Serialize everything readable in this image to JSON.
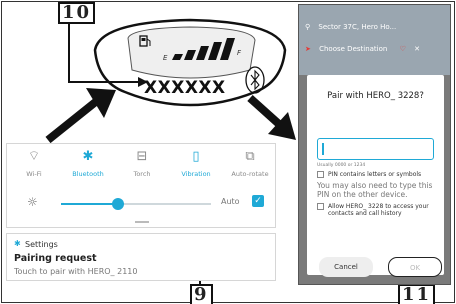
{
  "dashboard": {
    "code": "XXXXXX",
    "fuel_gauge": "E ▰▰▰▰▰ F"
  },
  "steps": {
    "step10": "10",
    "step9": "9",
    "step11": "11"
  },
  "quick_settings": {
    "tiles": [
      {
        "label": "Wi-Fi",
        "icon": "wifi-icon",
        "glyph": "⌔"
      },
      {
        "label": "Bluetooth",
        "icon": "bluetooth-icon",
        "glyph": "✱"
      },
      {
        "label": "Torch",
        "icon": "torch-icon",
        "glyph": "⊟"
      },
      {
        "label": "Vibration",
        "icon": "vibration-icon",
        "glyph": "▯"
      },
      {
        "label": "Auto-rotate",
        "icon": "rotate-icon",
        "glyph": "⧉"
      }
    ],
    "brightness_level": 0.38,
    "auto_label": "Auto",
    "auto_checked": true
  },
  "notification": {
    "app_name": "Settings",
    "title": "Pairing request",
    "body": "Touch to pair with HERO_ 2110"
  },
  "phone": {
    "location": "Sector 37C, Hero Ho...",
    "destination_placeholder": "Choose Destination",
    "dialog": {
      "title": "Pair with HERO_ 3228?",
      "pin_hint": "Usually 0000 or 1234",
      "checkbox_letters": "PIN contains letters or symbols",
      "note": "You may also need to type this PIN on the other device.",
      "checkbox_access": "Allow HERO_ 3228 to access your contacts and call history",
      "cancel": "Cancel",
      "ok": "OK"
    }
  },
  "colors": {
    "accent": "#1fa9d6",
    "phone_bg": "#7a7a7a"
  }
}
